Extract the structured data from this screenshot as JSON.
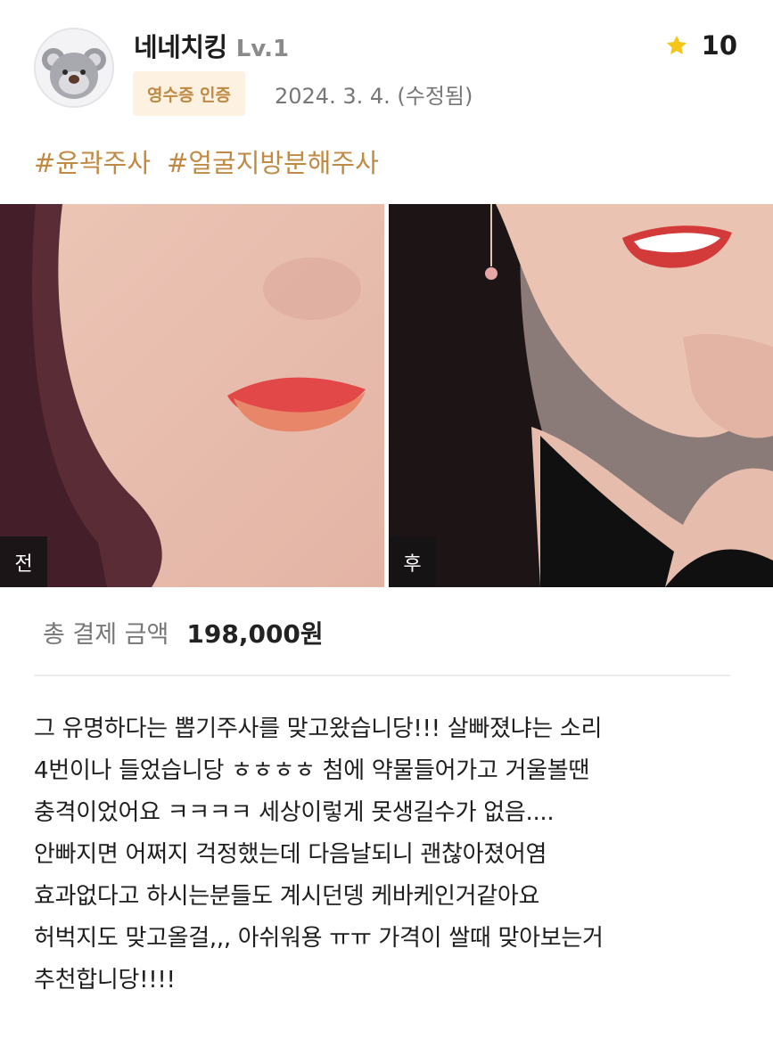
{
  "user": {
    "name": "네네치킹",
    "level": "Lv.1",
    "badge": "영수증 인증",
    "date": "2024. 3. 4. (수정됨)",
    "avatar": "koala-avatar"
  },
  "rating": {
    "icon": "star-icon",
    "value": "10",
    "star_color": "#f5c518"
  },
  "tags": [
    "#윤곽주사",
    "#얼굴지방분해주사"
  ],
  "photos": {
    "before": {
      "label": "전"
    },
    "after": {
      "label": "후"
    }
  },
  "payment": {
    "label": "총 결제 금액",
    "value": "198,000원"
  },
  "review": {
    "lines": [
      "그 유명하다는 뽑기주사를 맞고왔습니당!!! 살빠졌냐는 소리",
      "4번이나 들었습니당 ㅎㅎㅎㅎ 첨에 약물들어가고 거울볼땐",
      "충격이었어요 ㅋㅋㅋㅋ 세상이렇게 못생길수가 없음....",
      "안빠지면 어쩌지 걱정했는데 다음날되니 괜찮아졌어염",
      "효과없다고 하시는분들도 계시던뎅 케바케인거같아요",
      "허벅지도 맞고올걸,,, 아쉬워용 ㅠㅠ 가격이 쌀때 맞아보는거",
      "추천합니당!!!!"
    ]
  },
  "colors": {
    "accent": "#c08a44",
    "badge_bg": "#fdf1e1",
    "muted": "#777777"
  }
}
